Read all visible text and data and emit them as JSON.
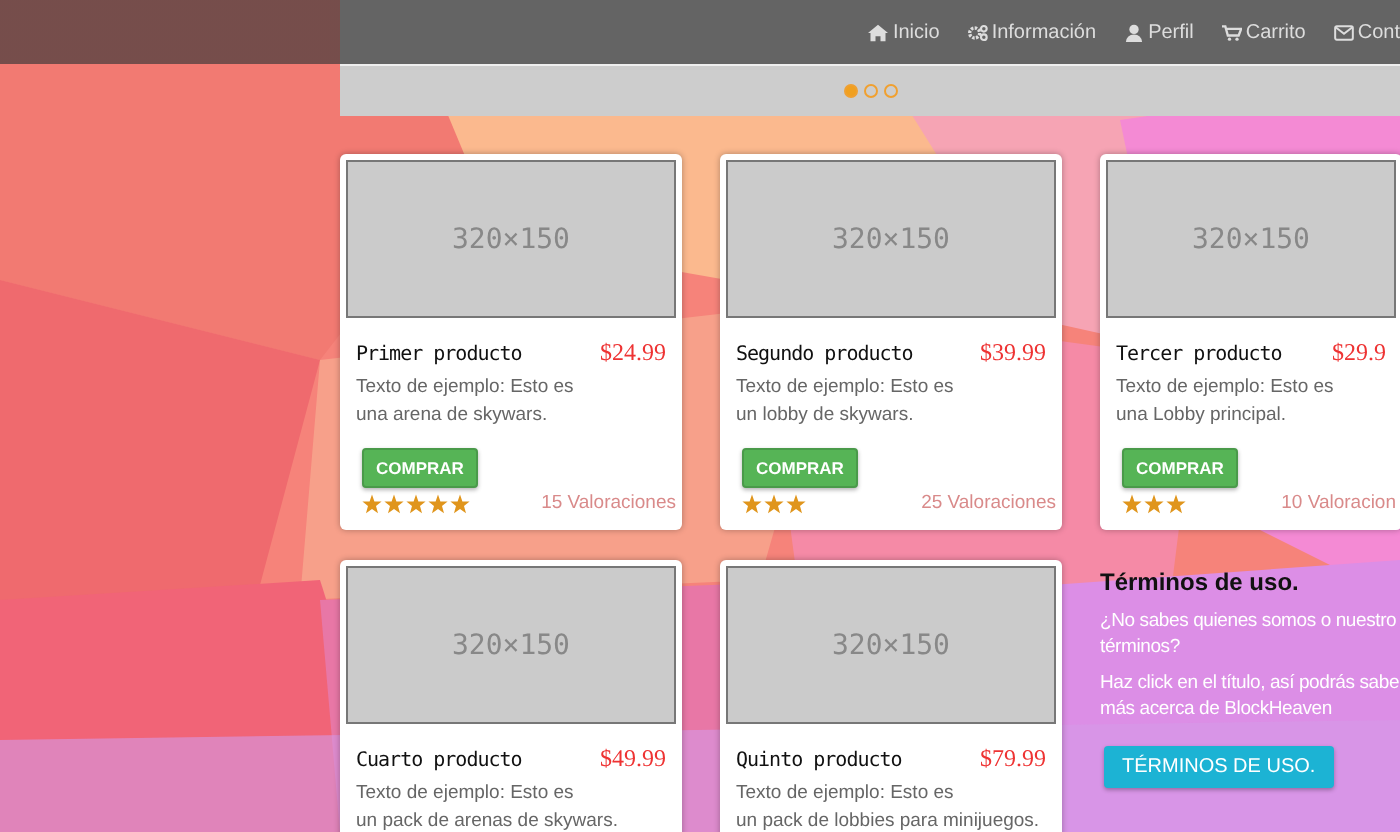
{
  "navbar": {
    "items": [
      {
        "label": "Inicio"
      },
      {
        "label": "Información"
      },
      {
        "label": "Perfil"
      },
      {
        "label": "Carrito"
      },
      {
        "label": "Cont"
      }
    ]
  },
  "carousel": {
    "dots": [
      {
        "selected": true
      },
      {
        "selected": false
      },
      {
        "selected": false
      }
    ]
  },
  "products": [
    {
      "image_label": "320×150",
      "name": "Primer producto",
      "price": "$24.99",
      "description": "Texto de ejemplo: Esto es\nuna arena de skywars.",
      "button": "COMPRAR",
      "stars": 5,
      "ratings": "15 Valoraciones"
    },
    {
      "image_label": "320×150",
      "name": "Segundo producto",
      "price": "$39.99",
      "description": "Texto de ejemplo: Esto es\nun lobby de skywars.",
      "button": "COMPRAR",
      "stars": 3,
      "ratings": "25 Valoraciones"
    },
    {
      "image_label": "320×150",
      "name": "Tercer producto",
      "price": "$29.9",
      "description": "Texto de ejemplo: Esto es\nuna Lobby principal.",
      "button": "COMPRAR",
      "stars": 3,
      "ratings": "10 Valoracion"
    },
    {
      "image_label": "320×150",
      "name": "Cuarto producto",
      "price": "$49.99",
      "description": "Texto de ejemplo: Esto es\nun pack de arenas de skywars."
    },
    {
      "image_label": "320×150",
      "name": "Quinto producto",
      "price": "$79.99",
      "description": "Texto de ejemplo: Esto es\nun pack de lobbies para minijuegos."
    }
  ],
  "terms": {
    "title": "Términos de uso.",
    "paragraphs": [
      "¿No sabes quienes somos o nuestro\ntérminos?",
      "Haz click en el título, así podrás sabe\nmás acerca de BlockHeaven"
    ],
    "button": "TÉRMINOS DE USO."
  }
}
